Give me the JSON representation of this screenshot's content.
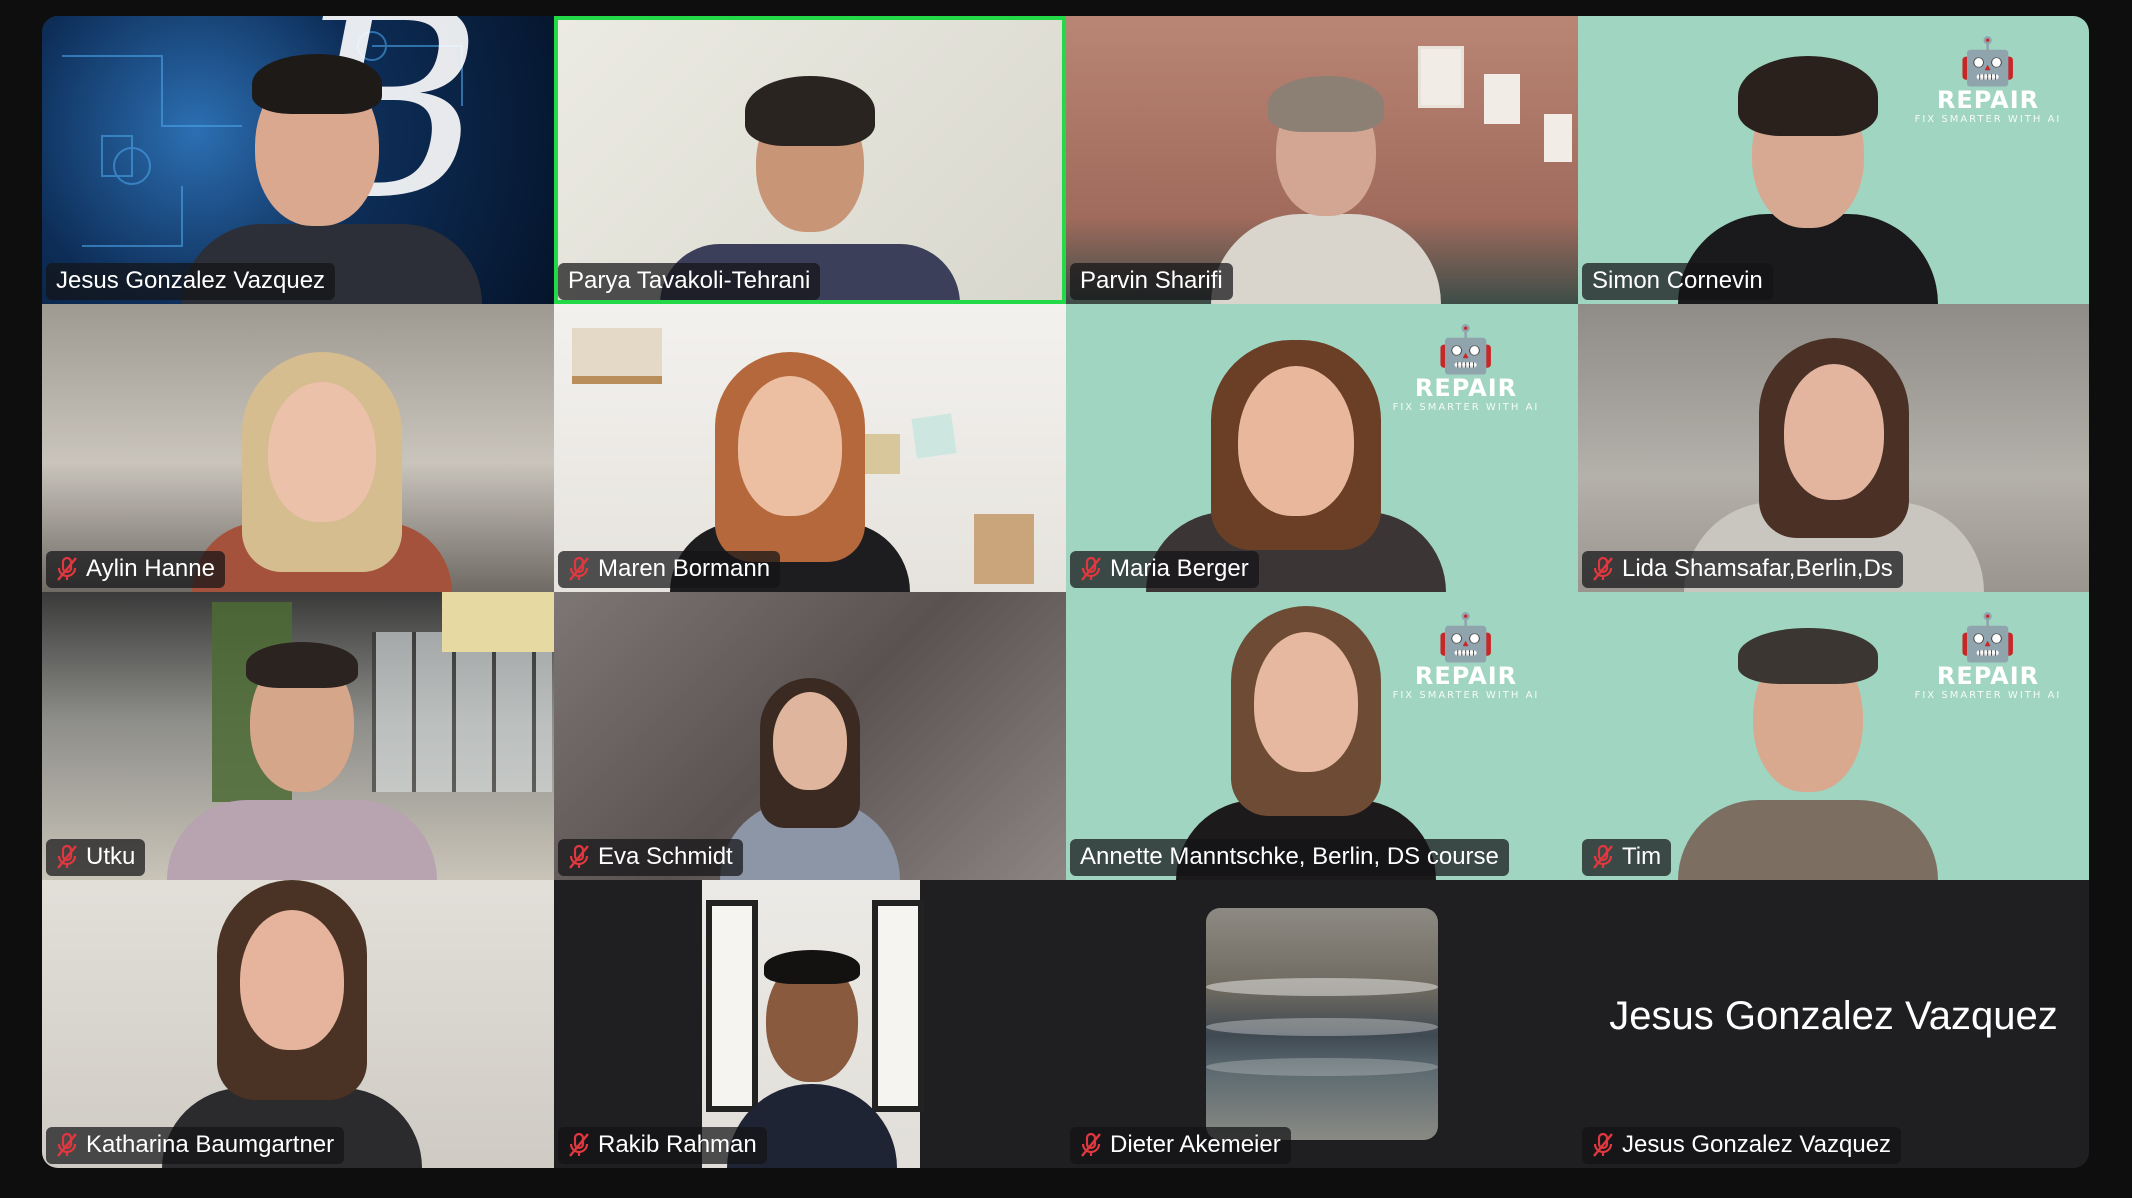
{
  "meeting": {
    "active_speaker": "Parya Tavakoli-Tehrani",
    "accent_color": "#23d947",
    "label_bg": "#141416"
  },
  "participants": [
    {
      "name": "Jesus Gonzalez Vazquez",
      "muted": false
    },
    {
      "name": "Parya Tavakoli-Tehrani",
      "muted": false,
      "active": true
    },
    {
      "name": "Parvin Sharifi",
      "muted": false
    },
    {
      "name": "Simon Cornevin",
      "muted": false
    },
    {
      "name": "Aylin Hanne",
      "muted": true
    },
    {
      "name": "Maren Bormann",
      "muted": true
    },
    {
      "name": "Maria Berger",
      "muted": true
    },
    {
      "name": "Lida Shamsafar,Berlin,Ds",
      "muted": true
    },
    {
      "name": "Utku",
      "muted": true
    },
    {
      "name": "Eva Schmidt",
      "muted": true
    },
    {
      "name": "Annette Manntschke, Berlin, DS course",
      "muted": false
    },
    {
      "name": "Tim",
      "muted": true
    },
    {
      "name": "Katharina Baumgartner",
      "muted": true
    },
    {
      "name": "Rakib Rahman",
      "muted": true
    },
    {
      "name": "Dieter Akemeier",
      "muted": true,
      "video_off": true
    },
    {
      "name": "Jesus Gonzalez Vazquez",
      "muted": true,
      "video_off": true,
      "display_name": "Jesus Gonzalez Vazquez"
    }
  ],
  "repair_logo": {
    "word": "REPAIR",
    "tagline": "FIX SMARTER WITH AI"
  },
  "icons": {
    "mic_muted": "mic-muted-icon",
    "robot_logo": "robot-logo-icon"
  }
}
